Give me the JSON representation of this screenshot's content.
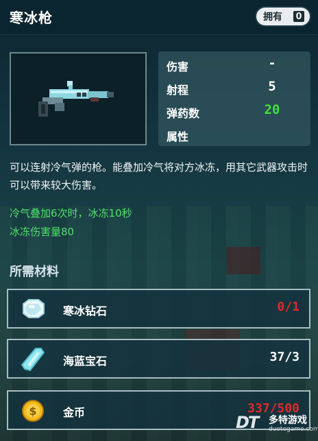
{
  "header": {
    "title": "寒冰枪",
    "owned_label": "拥有",
    "owned_count": "0"
  },
  "weapon": {
    "icon": "ice-gun-icon",
    "stats": [
      {
        "label": "伤害",
        "value": "-"
      },
      {
        "label": "射程",
        "value": "5"
      },
      {
        "label": "弹药数",
        "value": "20"
      },
      {
        "label": "属性",
        "value": ""
      }
    ]
  },
  "description": "可以连射冷气弹的枪。能叠加冷气将对方冰冻，用其它武器攻击时可以带来较大伤害。",
  "effects": [
    "冷气叠加6次时，冰冻10秒",
    "冰冻伤害量80"
  ],
  "materials_title": "所需材料",
  "materials": [
    {
      "name": "寒冰钻石",
      "qty": "0/1",
      "icon": "ice-diamond-icon",
      "qty_color": "#e02a2a"
    },
    {
      "name": "海蓝宝石",
      "qty": "37/3",
      "icon": "aquamarine-icon",
      "qty_color": "#ffffff"
    },
    {
      "name": "金币",
      "qty": "337/500",
      "icon": "gold-coin-icon",
      "qty_color": "#e02a2a"
    }
  ],
  "watermark": {
    "logo": "DT",
    "text": "多特游戏",
    "url": "duotegame.com"
  },
  "colors": {
    "ammo": "#3fe03a",
    "effect": "#4fe06a",
    "insufficient": "#e02a2a"
  }
}
